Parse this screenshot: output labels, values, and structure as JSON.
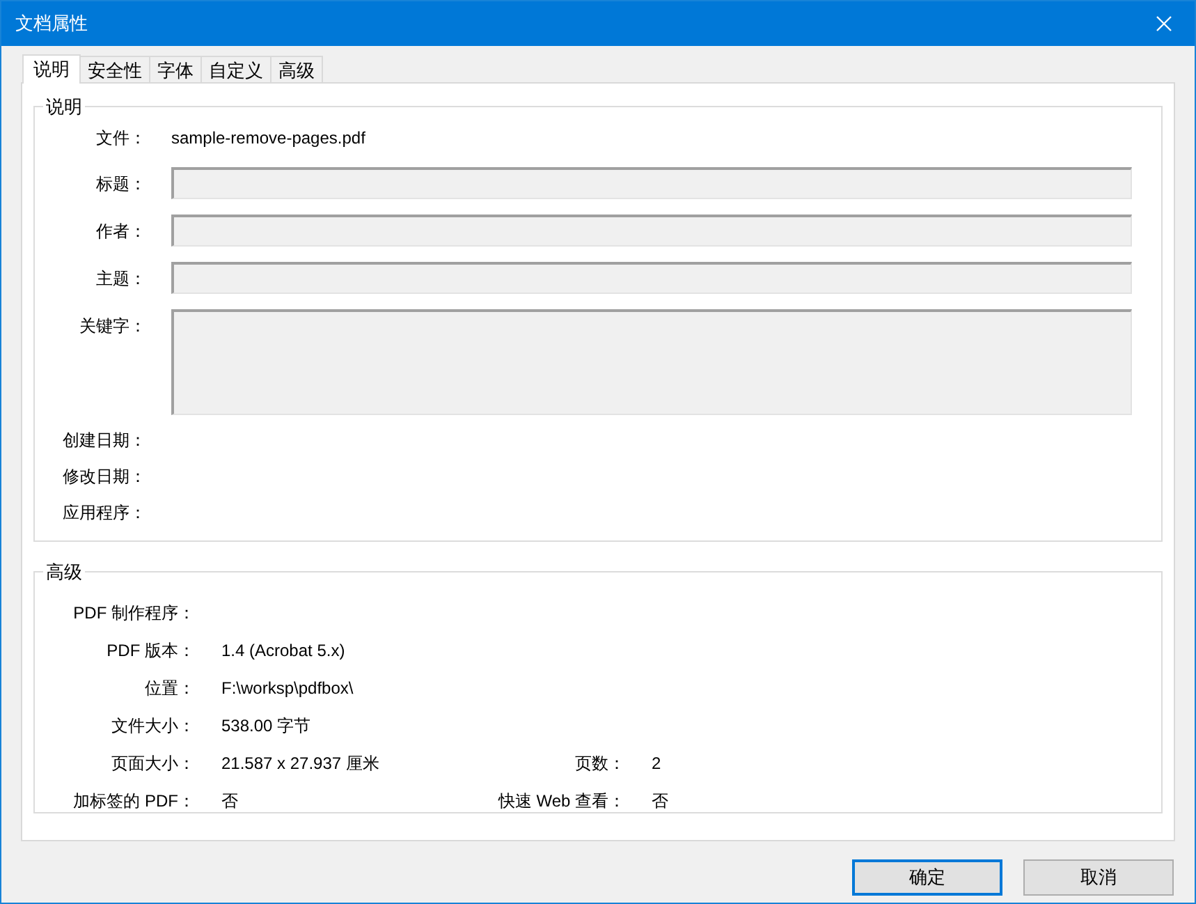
{
  "window": {
    "title": "文档属性"
  },
  "tabs": [
    {
      "label": "说明",
      "selected": true
    },
    {
      "label": "安全性",
      "selected": false
    },
    {
      "label": "字体",
      "selected": false
    },
    {
      "label": "自定义",
      "selected": false
    },
    {
      "label": "高级",
      "selected": false
    }
  ],
  "description": {
    "legend": "说明",
    "file": {
      "label": "文件：",
      "value": "sample-remove-pages.pdf"
    },
    "fields": [
      {
        "label": "标题：",
        "kind": "line"
      },
      {
        "label": "作者：",
        "kind": "line"
      },
      {
        "label": "主题：",
        "kind": "line"
      },
      {
        "label": "关键字：",
        "kind": "area"
      }
    ],
    "dates": [
      {
        "label": "创建日期："
      },
      {
        "label": "修改日期："
      },
      {
        "label": "应用程序："
      }
    ]
  },
  "advanced": {
    "legend": "高级",
    "rows": [
      {
        "label": "PDF 制作程序："
      },
      {
        "label": "PDF 版本：",
        "value": "1.4 (Acrobat 5.x)"
      },
      {
        "label": "位置：",
        "value": "F:\\worksp\\pdfbox\\"
      },
      {
        "label": "文件大小：",
        "value": "538.00 字节"
      },
      {
        "label": "页面大小：",
        "value": "21.587 x 27.937 厘米",
        "label2": "页数：",
        "value2": "2"
      },
      {
        "label": "加标签的 PDF：",
        "value": "否",
        "label2": "快速 Web 查看：",
        "value2": "否"
      }
    ]
  },
  "buttons": [
    {
      "label": "确定",
      "default": true
    },
    {
      "label": "取消",
      "default": false
    }
  ]
}
